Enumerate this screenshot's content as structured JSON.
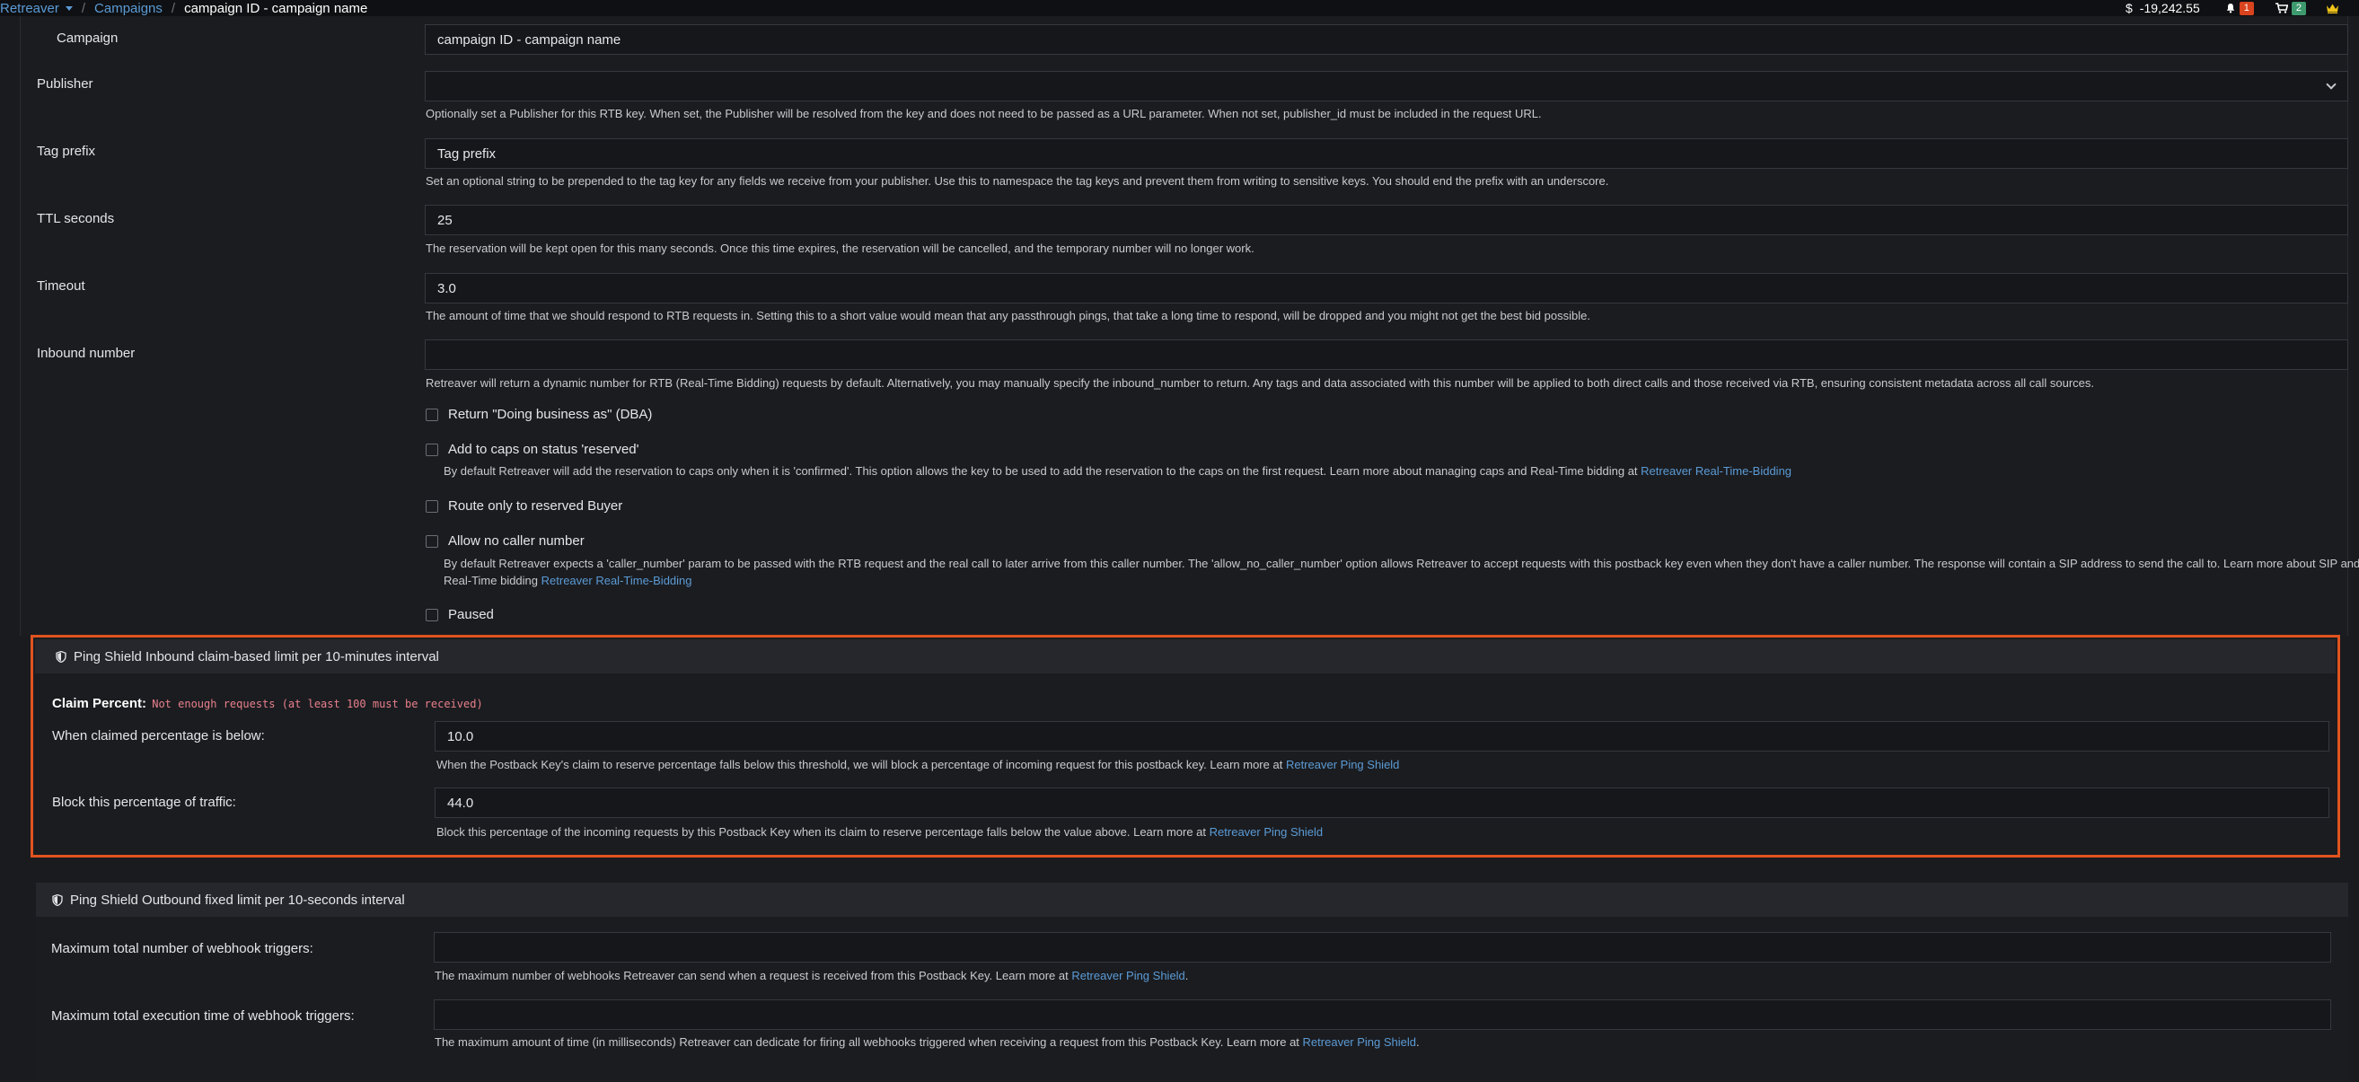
{
  "breadcrumb": {
    "root": "Retreaver",
    "section": "Campaigns",
    "current": "campaign ID - campaign name"
  },
  "topbar": {
    "currency_symbol": "$",
    "balance": "-19,242.55",
    "notifications_count": "1",
    "cart_count": "2"
  },
  "form": {
    "campaign": {
      "label": "Campaign",
      "value": "campaign ID - campaign name"
    },
    "publisher": {
      "label": "Publisher",
      "value": "",
      "help": "Optionally set a Publisher for this RTB key. When set, the Publisher will be resolved from the key and does not need to be passed as a URL parameter. When not set, publisher_id must be included in the request URL."
    },
    "tag_prefix": {
      "label": "Tag prefix",
      "placeholder": "Tag prefix",
      "help": "Set an optional string to be prepended to the tag key for any fields we receive from your publisher. Use this to namespace the tag keys and prevent them from writing to sensitive keys. You should end the prefix with an underscore."
    },
    "ttl": {
      "label": "TTL seconds",
      "value": "25",
      "help": "The reservation will be kept open for this many seconds. Once this time expires, the reservation will be cancelled, and the temporary number will no longer work."
    },
    "timeout": {
      "label": "Timeout",
      "value": "3.0",
      "help": "The amount of time that we should respond to RTB requests in. Setting this to a short value would mean that any passthrough pings, that take a long time to respond, will be dropped and you might not get the best bid possible."
    },
    "inbound_number": {
      "label": "Inbound number",
      "value": "",
      "help": "Retreaver will return a dynamic number for RTB (Real-Time Bidding) requests by default. Alternatively, you may manually specify the inbound_number to return. Any tags and data associated with this number will be applied to both direct calls and those received via RTB, ensuring consistent metadata across all call sources."
    },
    "dba": {
      "label": "Return \"Doing business as\" (DBA)"
    },
    "caps_reserved": {
      "label": "Add to caps on status 'reserved'",
      "help": "By default Retreaver will add the reservation to caps only when it is 'confirmed'. This option allows the key to be used to add the reservation to the caps on the first request. Learn more about managing caps and Real-Time bidding at",
      "link": "Retreaver Real-Time-Bidding"
    },
    "route_reserved": {
      "label": "Route only to reserved Buyer"
    },
    "no_caller": {
      "label": "Allow no caller number",
      "help": "By default Retreaver expects a 'caller_number' param to be passed with the RTB request and the real call to later arrive from this caller number. The 'allow_no_caller_number' option allows Retreaver to accept requests with this postback key even when they don't have a caller number. The response will contain a SIP address to send the call to. Learn more about SIP and Real-Time bidding",
      "link": "Retreaver Real-Time-Bidding"
    },
    "paused": {
      "label": "Paused"
    }
  },
  "inbound_shield": {
    "title": "Ping Shield Inbound claim-based limit per 10-minutes interval",
    "claim_label": "Claim Percent:",
    "claim_message": "Not enough requests (at least 100 must be received)",
    "threshold": {
      "label": "When claimed percentage is below:",
      "value": "10.0",
      "help": "When the Postback Key's claim to reserve percentage falls below this threshold, we will block a percentage of incoming request for this postback key. Learn more at",
      "link": "Retreaver Ping Shield"
    },
    "block": {
      "label": "Block this percentage of traffic:",
      "value": "44.0",
      "help": "Block this percentage of the incoming requests by this Postback Key when its claim to reserve percentage falls below the value above. Learn more at",
      "link": "Retreaver Ping Shield"
    }
  },
  "outbound_shield": {
    "title": "Ping Shield Outbound fixed limit per 10-seconds interval",
    "max_triggers": {
      "label": "Maximum total number of webhook triggers:",
      "value": "",
      "help": "The maximum number of webhooks Retreaver can send when a request is received from this Postback Key. Learn more at",
      "link": "Retreaver Ping Shield",
      "suffix": "."
    },
    "max_time": {
      "label": "Maximum total execution time of webhook triggers:",
      "value": "",
      "help": "The maximum amount of time (in milliseconds) Retreaver can dedicate for firing all webhooks triggered when receiving a request from this Postback Key. Learn more at",
      "link": "Retreaver Ping Shield",
      "suffix": "."
    }
  },
  "colors": {
    "accent_link": "#5b9bd5",
    "highlight_border": "#e0531f",
    "badge_red": "#d9431e",
    "badge_green": "#3e9a6e",
    "claim_message": "#e8808c"
  },
  "icons": {
    "notifications": "bell-icon",
    "cart": "cart-icon",
    "account": "crown-icon",
    "shield": "shield-icon",
    "dropdown": "chevron-down-icon"
  }
}
